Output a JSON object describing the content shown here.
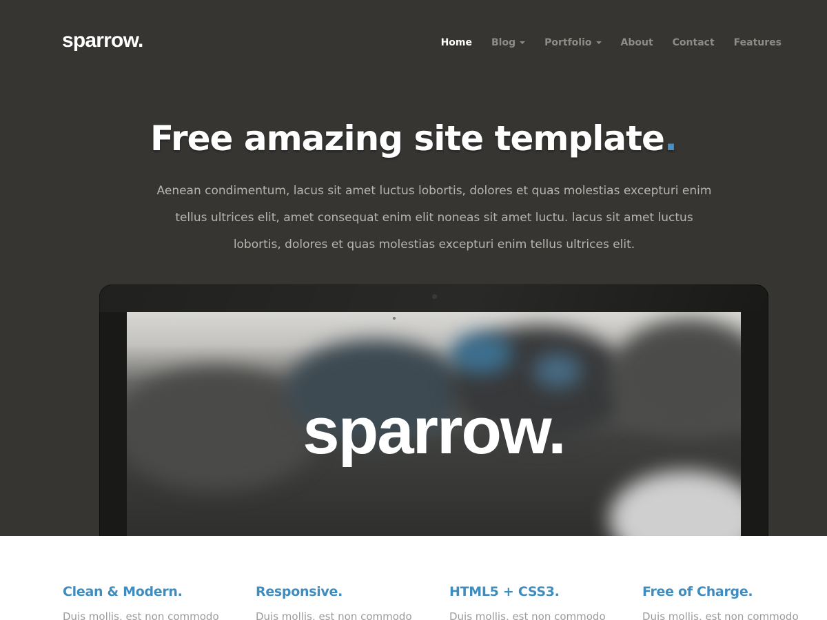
{
  "brand": {
    "logo": "sparrow."
  },
  "nav": {
    "items": [
      {
        "label": "Home",
        "active": true,
        "dropdown": false
      },
      {
        "label": "Blog",
        "active": false,
        "dropdown": true
      },
      {
        "label": "Portfolio",
        "active": false,
        "dropdown": true
      },
      {
        "label": "About",
        "active": false,
        "dropdown": false
      },
      {
        "label": "Contact",
        "active": false,
        "dropdown": false
      },
      {
        "label": "Features",
        "active": false,
        "dropdown": false
      }
    ]
  },
  "hero": {
    "headline": "Free amazing site template",
    "headline_dot": ".",
    "lead": "Aenean condimentum, lacus sit amet luctus lobortis, dolores et quas molestias excepturi enim tellus ultrices elit, amet consequat enim elit noneas sit amet luctu. lacus sit amet luctus lobortis, dolores et quas molestias excepturi enim tellus ultrices elit.",
    "screen_logo": "sparrow."
  },
  "features": [
    {
      "title": "Clean & Modern.",
      "text": "Duis mollis, est non commodo"
    },
    {
      "title": "Responsive.",
      "text": "Duis mollis, est non commodo"
    },
    {
      "title": "HTML5 + CSS3.",
      "text": "Duis mollis, est non commodo"
    },
    {
      "title": "Free of Charge.",
      "text": "Duis mollis, est non commodo"
    }
  ],
  "colors": {
    "hero_bg": "#363532",
    "accent": "#3f8cbf",
    "nav_inactive": "#8d8c87",
    "nav_active": "#ffffff"
  },
  "icons": [
    "caret-down-icon",
    "camera-icon"
  ]
}
